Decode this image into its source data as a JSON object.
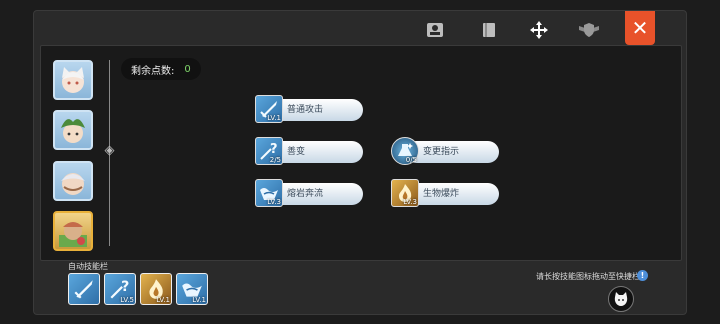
{
  "header": {
    "tabs": [
      {
        "icon": "profile-card-icon",
        "active": false
      },
      {
        "icon": "book-icon",
        "active": false
      },
      {
        "icon": "move-arrows-icon",
        "active": true
      },
      {
        "icon": "shield-wings-icon",
        "active": false
      }
    ],
    "close_label": "✕"
  },
  "party": [
    {
      "name": "portrait-1"
    },
    {
      "name": "portrait-2"
    },
    {
      "name": "portrait-3"
    },
    {
      "name": "portrait-4",
      "selected": true
    }
  ],
  "points": {
    "label": "剩余点数:",
    "value": "0"
  },
  "skills": [
    {
      "label": "普通攻击",
      "level": "LV.1",
      "icon": "sword-icon",
      "style": "blue"
    },
    {
      "label": "善变",
      "level": "2/5",
      "icon": "question-blade-icon",
      "style": "blue"
    },
    {
      "label": "变更指示",
      "level": "0/5",
      "icon": "sparkle-flask-icon",
      "style": "round"
    },
    {
      "label": "熔岩奔流",
      "level": "LV.3",
      "icon": "lava-wave-icon",
      "style": "blue"
    },
    {
      "label": "生物爆炸",
      "level": "LV.3",
      "icon": "flame-icon",
      "style": "gold"
    }
  ],
  "auto_bar": {
    "label": "自动技能栏",
    "slots": [
      {
        "icon": "sword-icon",
        "level": "",
        "style": "blue"
      },
      {
        "icon": "question-blade-icon",
        "level": "LV.5",
        "style": "blue"
      },
      {
        "icon": "flame-icon",
        "level": "LV.1",
        "style": "gold"
      },
      {
        "icon": "lava-wave-icon",
        "level": "LV.1",
        "style": "blue"
      }
    ]
  },
  "hint": "请长按技能图标拖动至快捷栏",
  "colors": {
    "accent": "#e8522a",
    "points_value": "#7fd46a",
    "selected_border": "#e9b13a"
  }
}
